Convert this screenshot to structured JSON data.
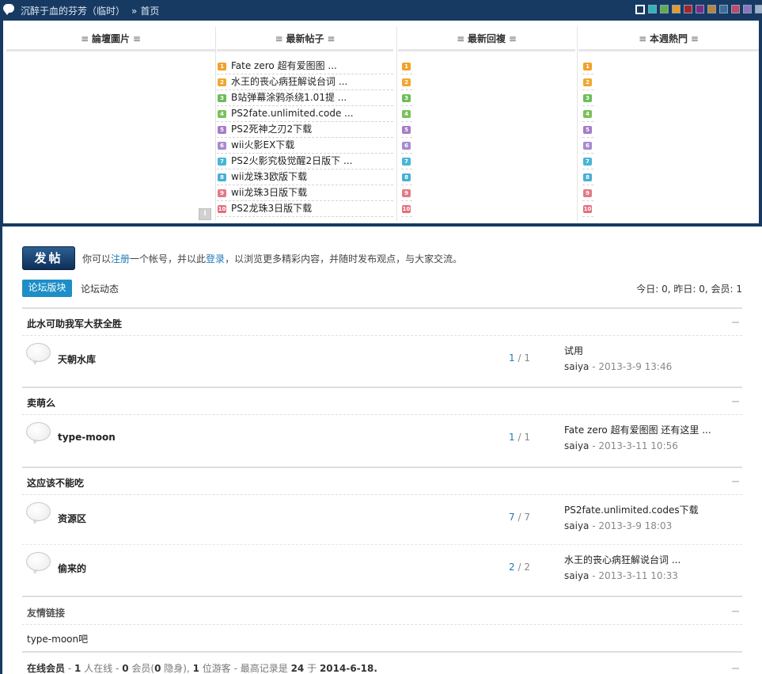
{
  "topbar": {
    "site_name": "沉醉于血的芬芳（临时）",
    "separator": "»",
    "home": "首页",
    "theme_colors": [
      "#173a63",
      "#2fb5b5",
      "#5fae4d",
      "#e49a2a",
      "#a8242b",
      "#7b2d86",
      "#b5863c",
      "#3c6e9c",
      "#c14a6c",
      "#8a76c2",
      "#9fb1c6",
      "#7b8fa6"
    ]
  },
  "portal": {
    "columns": [
      {
        "title": "論壇圖片"
      },
      {
        "title": "最新帖子"
      },
      {
        "title": "最新回複"
      },
      {
        "title": "本週熱門"
      }
    ],
    "latest_posts": [
      "Fate zero 超有爱图图 ...",
      "水王的丧心病狂解说台词 ...",
      "B站弹幕涂鸦杀绕1.01提 ...",
      "PS2fate.unlimited.code ...",
      "PS2死神之刃2下载",
      "wii火影EX下载",
      "PS2火影究极觉醒2日版下 ...",
      "wii龙珠3欧版下载",
      "wii龙珠3日版下载",
      "PS2龙珠3日版下载"
    ],
    "rank_numbers": [
      "1",
      "2",
      "3",
      "4",
      "5",
      "6",
      "7",
      "8",
      "9",
      "10"
    ],
    "info_button": "i"
  },
  "post_bar": {
    "post_button": "发帖",
    "notice_prefix": "你可以",
    "register_link": "注册",
    "notice_mid": "一个帐号，并以此",
    "login_link": "登录",
    "notice_suffix": "，以浏览更多精彩内容，并随时发布观点，与大家交流。"
  },
  "tabs": {
    "active": "论坛版块",
    "second": "论坛动态"
  },
  "stats": "今日: 0, 昨日: 0, 会员: 1",
  "groups": [
    {
      "title": "此水可助我军大获全胜",
      "forums": [
        {
          "name": "天朝水库",
          "threads": "1",
          "slash": "/",
          "posts": "1",
          "last_title": "试用",
          "last_user": "saiya",
          "last_time": "- 2013-3-9 13:46"
        }
      ]
    },
    {
      "title": "卖萌么",
      "forums": [
        {
          "name": "type-moon",
          "threads": "1",
          "slash": "/",
          "posts": "1",
          "last_title": "Fate zero 超有爱图图 还有这里 ...",
          "last_user": "saiya",
          "last_time": "- 2013-3-11 10:56"
        }
      ]
    },
    {
      "title": "这应该不能吃",
      "forums": [
        {
          "name": "资源区",
          "threads": "7",
          "slash": "/",
          "posts": "7",
          "last_title": "PS2fate.unlimited.codes下载",
          "last_user": "saiya",
          "last_time": "- 2013-3-9 18:03"
        },
        {
          "name": "偷来的",
          "threads": "2",
          "slash": "/",
          "posts": "2",
          "last_title": "水王的丧心病狂解说台词 ...",
          "last_user": "saiya",
          "last_time": "- 2013-3-11 10:33"
        }
      ]
    }
  ],
  "links": {
    "title": "友情链接",
    "items": [
      "type-moon吧"
    ]
  },
  "online": {
    "label": "在线会员",
    "online_count": "1",
    "t1": "人在线 -",
    "members": "0",
    "t2": "会员(",
    "hidden": "0",
    "t3": "隐身),",
    "guests": "1",
    "t4": "位游客 - 最高记录是",
    "record": "24",
    "t5": "于",
    "record_date": "2014-6-18",
    "dash": "-",
    "dot": "."
  }
}
